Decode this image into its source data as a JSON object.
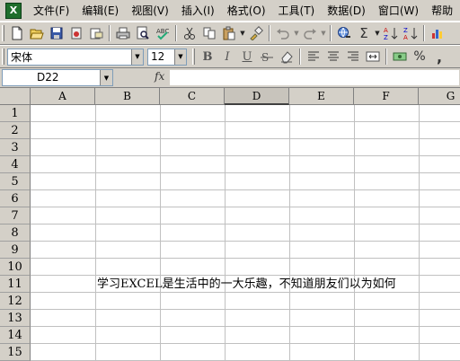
{
  "menu": {
    "items": [
      "文件(F)",
      "编辑(E)",
      "视图(V)",
      "插入(I)",
      "格式(O)",
      "工具(T)",
      "数据(D)",
      "窗口(W)",
      "帮助"
    ]
  },
  "toolbar": {
    "font_name": "宋体",
    "font_size": "12",
    "bold": "B",
    "italic": "I",
    "underline": "U",
    "sigma": "Σ",
    "percent": "%",
    "comma": ","
  },
  "formula_bar": {
    "name_box": "D22",
    "fx_label": "fx",
    "formula": ""
  },
  "sheet": {
    "columns": [
      "A",
      "B",
      "C",
      "D",
      "E",
      "F",
      "G"
    ],
    "active_column": "D",
    "rows": [
      "1",
      "2",
      "3",
      "4",
      "5",
      "6",
      "7",
      "8",
      "9",
      "10",
      "11",
      "12",
      "13",
      "14",
      "15"
    ],
    "cell_B11": "学习EXCEL是生活中的一大乐趣，不知道朋友们以为如何"
  }
}
